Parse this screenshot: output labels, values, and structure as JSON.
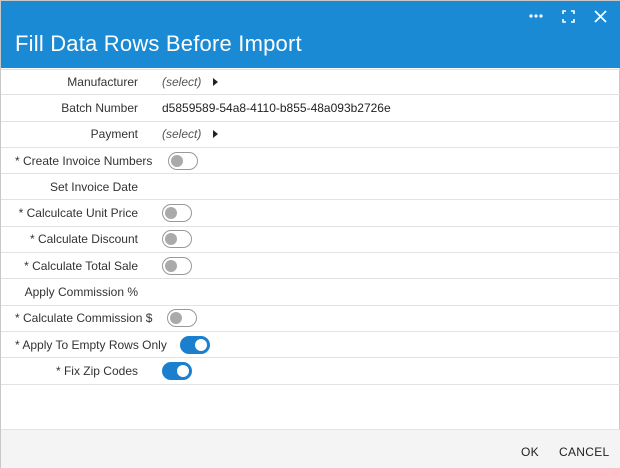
{
  "dialog": {
    "title": "Fill Data Rows Before Import",
    "header_icons": [
      "more-icon",
      "maximize-icon",
      "close-icon"
    ]
  },
  "fields": {
    "manufacturer": {
      "label": "Manufacturer",
      "value": "(select)"
    },
    "batch_number": {
      "label": "Batch Number",
      "value": "d5859589-54a8-4110-b855-48a093b2726e"
    },
    "payment": {
      "label": "Payment",
      "value": "(select)"
    },
    "create_invoice_numbers": {
      "label": "* Create Invoice Numbers",
      "on": false
    },
    "set_invoice_date": {
      "label": "Set Invoice Date"
    },
    "calculate_unit_price": {
      "label": "* Calculcate Unit Price",
      "on": false
    },
    "calculate_discount": {
      "label": "* Calculate Discount",
      "on": false
    },
    "calculate_total_sale": {
      "label": "* Calculate Total Sale",
      "on": false
    },
    "apply_commission": {
      "label": "Apply Commission %"
    },
    "calculate_commission": {
      "label": "* Calculate Commission $",
      "on": false
    },
    "apply_empty_rows": {
      "label": "* Apply To Empty Rows Only",
      "on": true
    },
    "fix_zip_codes": {
      "label": "* Fix Zip Codes",
      "on": true
    }
  },
  "footer": {
    "ok_label": "OK",
    "cancel_label": "CANCEL"
  },
  "colors": {
    "header_bg": "#1a8ad4",
    "toggle_on": "#1a7fce"
  }
}
